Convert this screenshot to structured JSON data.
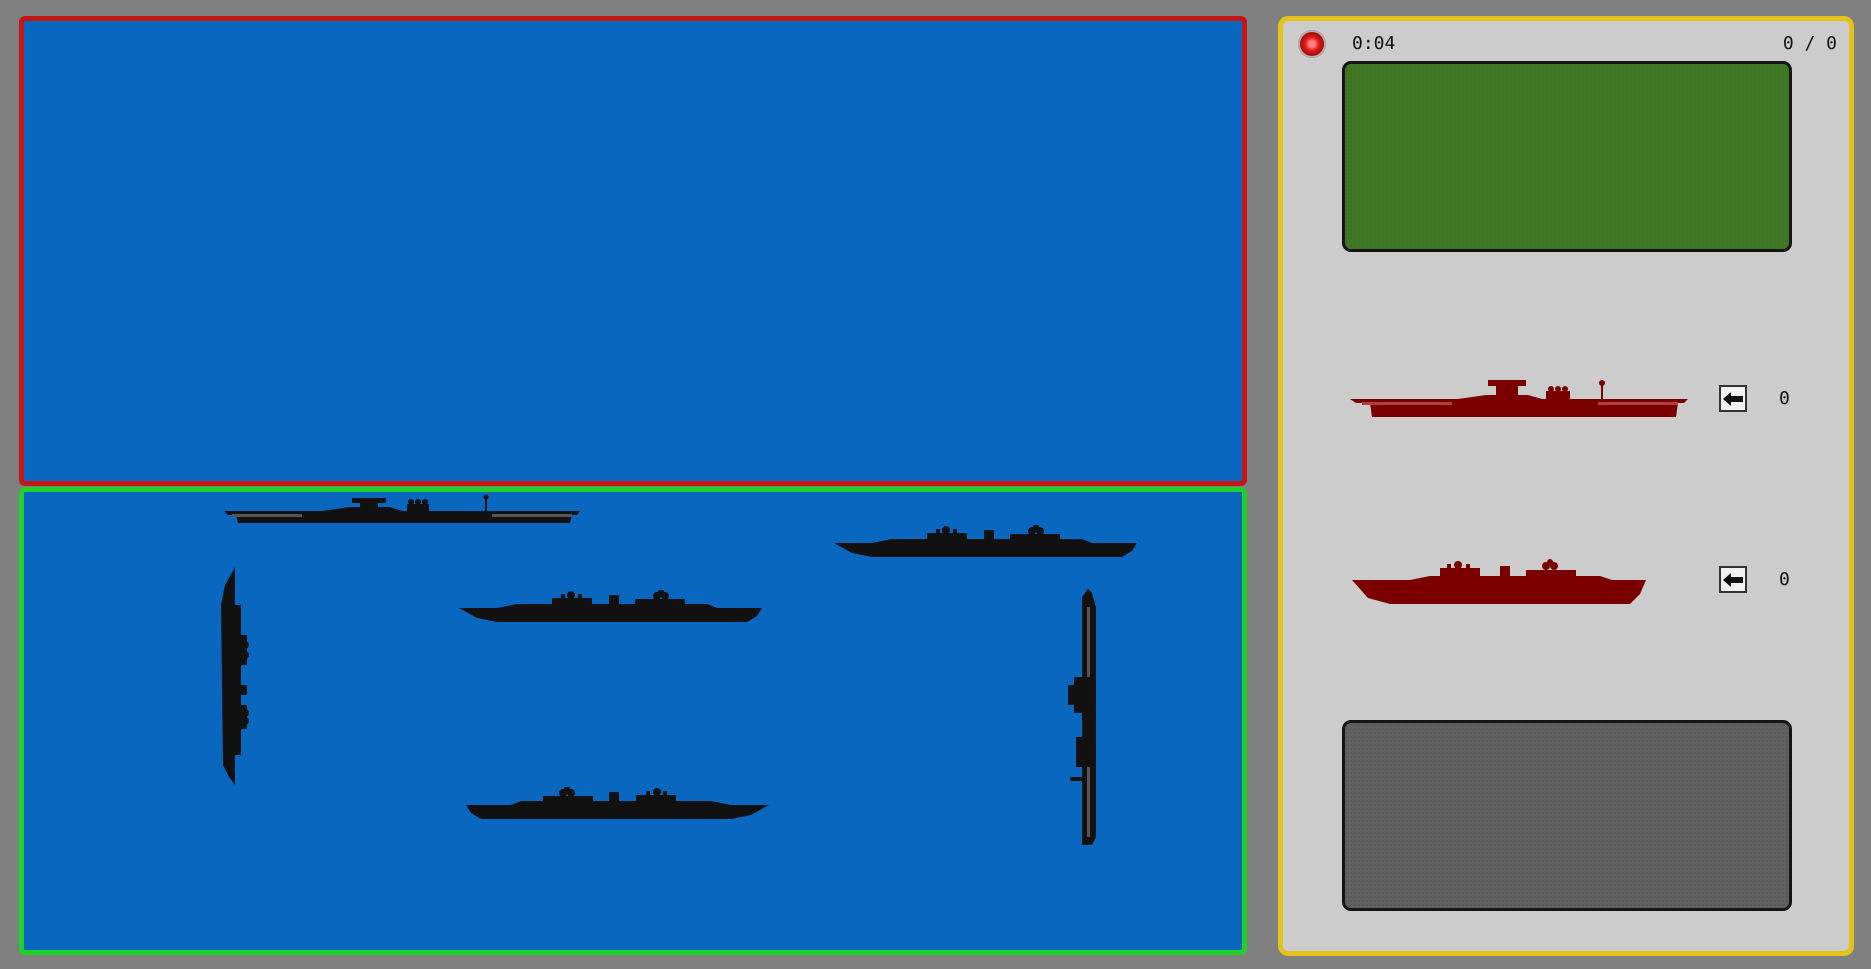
{
  "hud": {
    "timer": "0:04",
    "score": "0 / 0"
  },
  "colors": {
    "enemy_border": "#c51616",
    "player_border": "#1fcf2a",
    "panel_border": "#e2c21b",
    "sea": "#0967bf",
    "ship_player": "#111111",
    "ship_selector": "#7a0000"
  },
  "fleet": {
    "carrier_count": "0",
    "battleship_count": "0"
  },
  "icons": {
    "status": "status-light-icon",
    "arrow": "arrow-left-icon"
  }
}
